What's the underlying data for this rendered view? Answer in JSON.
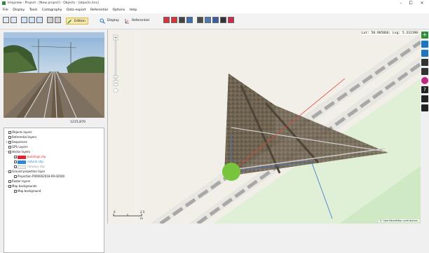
{
  "window": {
    "title": "Imajview - Project : [New project] - Objects : [objects.ilnx]",
    "minimize": "–",
    "maximize": "⧠",
    "close": "✕"
  },
  "menu": {
    "items": [
      "File",
      "Display",
      "Tools",
      "Cartography",
      "Data export",
      "Referential",
      "Options",
      "Help"
    ]
  },
  "toolbar": {
    "edition_label": "Edition",
    "display_label": "Display",
    "referential_label": "Referential"
  },
  "photo": {
    "caption": "1215,870"
  },
  "layers": {
    "items": [
      {
        "label": "Objects layers",
        "checked": false
      },
      {
        "label": "Referential layers",
        "checked": false
      },
      {
        "label": "Sequences",
        "checked": true
      },
      {
        "label": "GPS Layers",
        "checked": false
      },
      {
        "label": "Vector layers",
        "checked": true
      },
      {
        "label": "buildings.shp",
        "checked": true,
        "color": "#e3262e"
      },
      {
        "label": "natural.shp",
        "checked": true,
        "color": "#2f86d6"
      },
      {
        "label": "railways.shp",
        "checked": false,
        "color": "#eeeeee"
      },
      {
        "label": "Ground projection layer",
        "checked": true
      },
      {
        "label": "Projection P000002018-09-02000",
        "checked": true
      },
      {
        "label": "Raster layers",
        "checked": false
      },
      {
        "label": "Map backgrounds",
        "checked": true
      },
      {
        "label": "Map background",
        "checked": true
      }
    ]
  },
  "map": {
    "coords": "Lat: 50.985866; Lng: 5.331398",
    "attribution": "© OpenStreetMap contributors",
    "scale_labels": [
      "0",
      "2.5",
      "m"
    ],
    "zoom_in": "+",
    "zoom_out": "−"
  },
  "colors": {
    "edition_active": "#f7e7a8",
    "camera_point": "#78c43c",
    "fov_line_blue": "#3a6fd1",
    "fov_line_red": "#e0443a",
    "rail": "#a8a8a8",
    "grass": "#cfe9c5"
  },
  "icons": {
    "right_toolbar": [
      "add-icon",
      "pin-icon",
      "anchor-icon",
      "camera-icon",
      "speaker-icon",
      "target-icon",
      "help-icon",
      "pencil-icon",
      "square-icon"
    ]
  }
}
